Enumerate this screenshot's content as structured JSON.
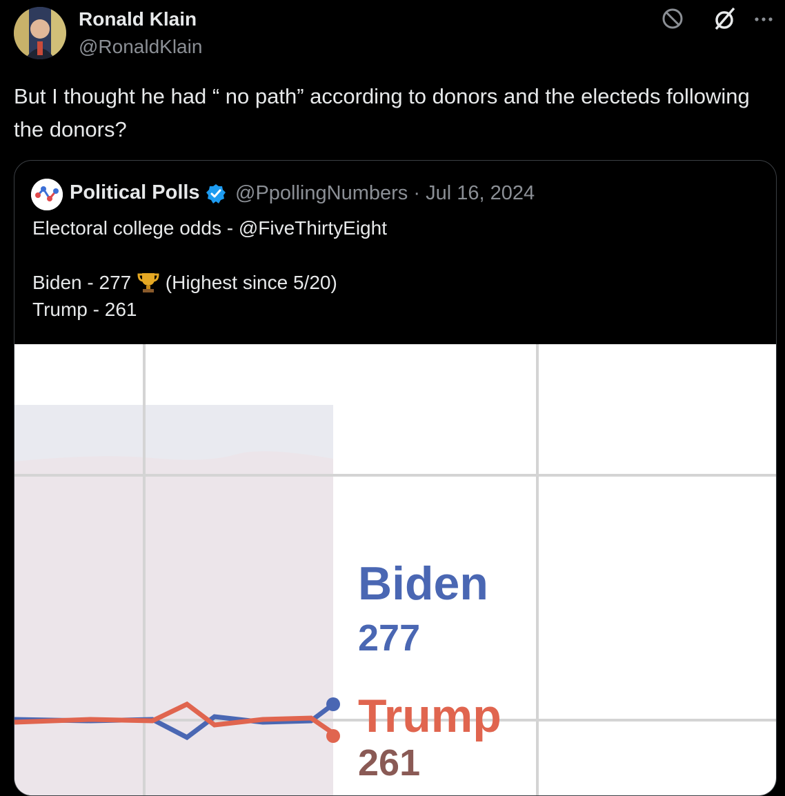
{
  "tweet": {
    "author_name": "Ronald Klain",
    "author_handle": "@RonaldKlain",
    "text": "But I thought he had “ no path” according to donors and the electeds following the donors?",
    "icons": [
      "block-icon",
      "grok-icon",
      "more-icon"
    ]
  },
  "quoted_tweet": {
    "author_name": "Political Polls",
    "author_handle": "@PpollingNumbers",
    "separator": "·",
    "date": "Jul 16, 2024",
    "line1": "Electoral college odds - @FiveThirtyEight",
    "line2_prefix": "Biden - 277",
    "line2_suffix": "(Highest since 5/20)",
    "line3": "Trump - 261",
    "emoji": "trophy-icon",
    "verified": "verified-badge-icon"
  },
  "chart_data": {
    "type": "line",
    "series": [
      {
        "name": "Biden",
        "values": [
          277
        ]
      },
      {
        "name": "Trump",
        "values": [
          261
        ]
      }
    ],
    "labels": [
      {
        "name": "Biden",
        "value": "277"
      },
      {
        "name": "Trump",
        "value": "261"
      }
    ],
    "colors": {
      "Biden": "#4a67b3",
      "Trump": "#e0654f"
    },
    "grid": true
  },
  "colors": {
    "background": "#000000",
    "text": "#e7e9ea",
    "secondary": "#8b8f95",
    "verified": "#1d9bf0",
    "border": "#3b3f44"
  }
}
